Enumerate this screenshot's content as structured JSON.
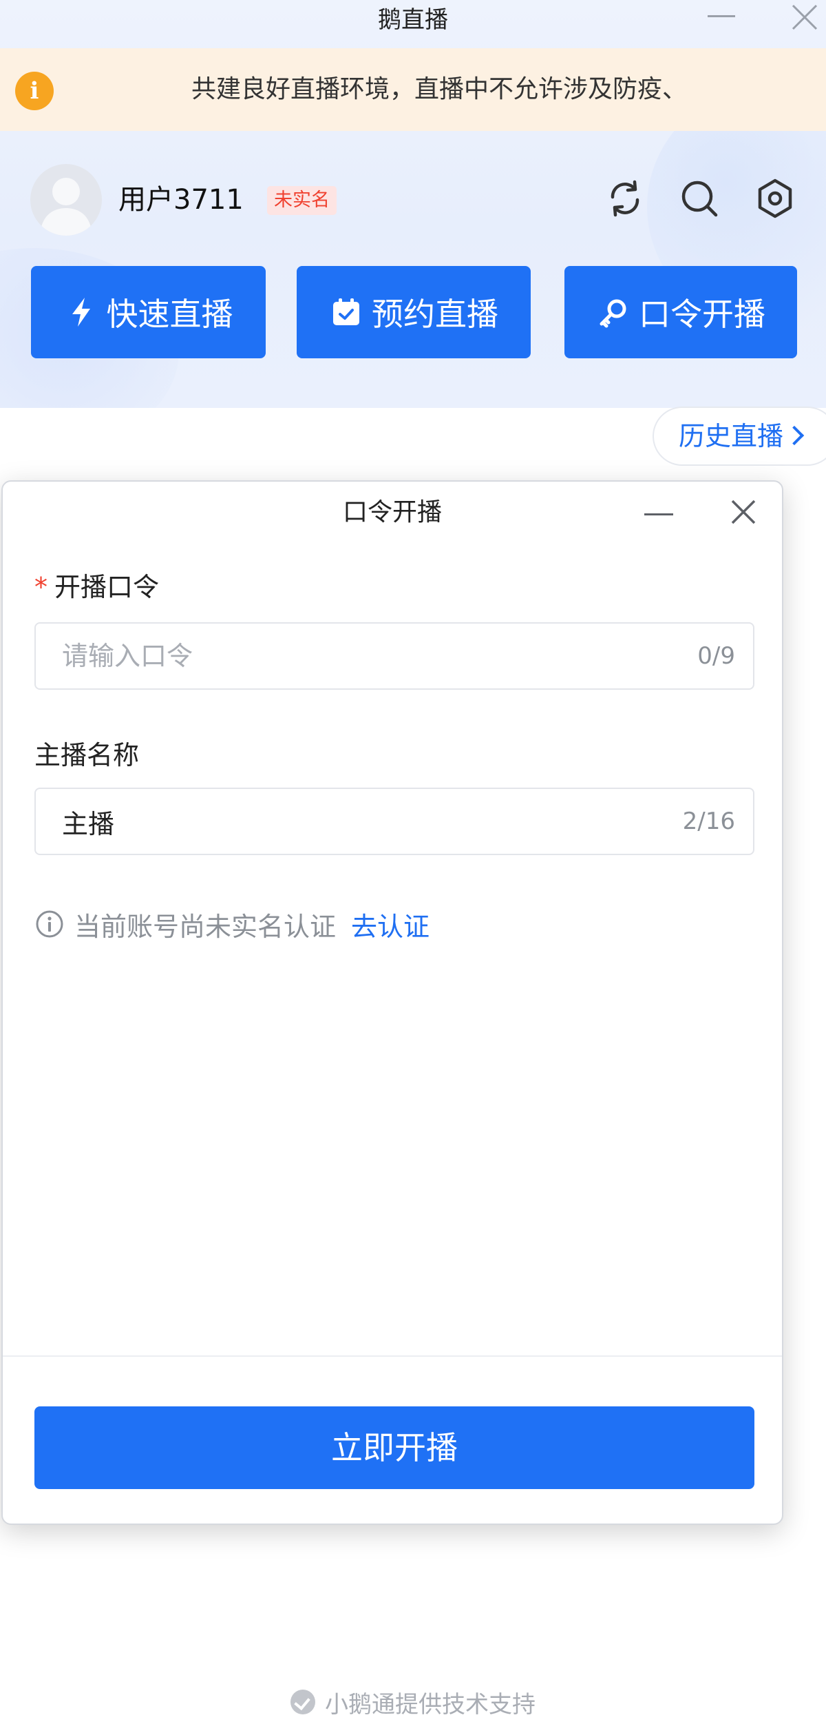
{
  "window": {
    "title": "鹅直播"
  },
  "notice": {
    "text": "共建良好直播环境，直播中不允许涉及防疫、"
  },
  "user": {
    "name": "用户3711",
    "badge": "未实名"
  },
  "actions": [
    {
      "label": "快速直播",
      "icon": "lightning-icon"
    },
    {
      "label": "预约直播",
      "icon": "calendar-check-icon"
    },
    {
      "label": "口令开播",
      "icon": "key-icon"
    }
  ],
  "history": {
    "label": "历史直播"
  },
  "dialog": {
    "title": "口令开播",
    "passcode": {
      "label": "开播口令",
      "required_mark": "*",
      "placeholder": "请输入口令",
      "value": "",
      "counter": "0/9"
    },
    "anchor": {
      "label": "主播名称",
      "value": "主播",
      "counter": "2/16"
    },
    "verify": {
      "text": "当前账号尚未实名认证",
      "link": "去认证"
    },
    "submit_label": "立即开播"
  },
  "footer": {
    "text": "小鹅通提供技术支持"
  },
  "colors": {
    "primary": "#1f71f5",
    "link": "#1f6ff2",
    "warning": "#f7a521",
    "danger": "#f0412f"
  }
}
